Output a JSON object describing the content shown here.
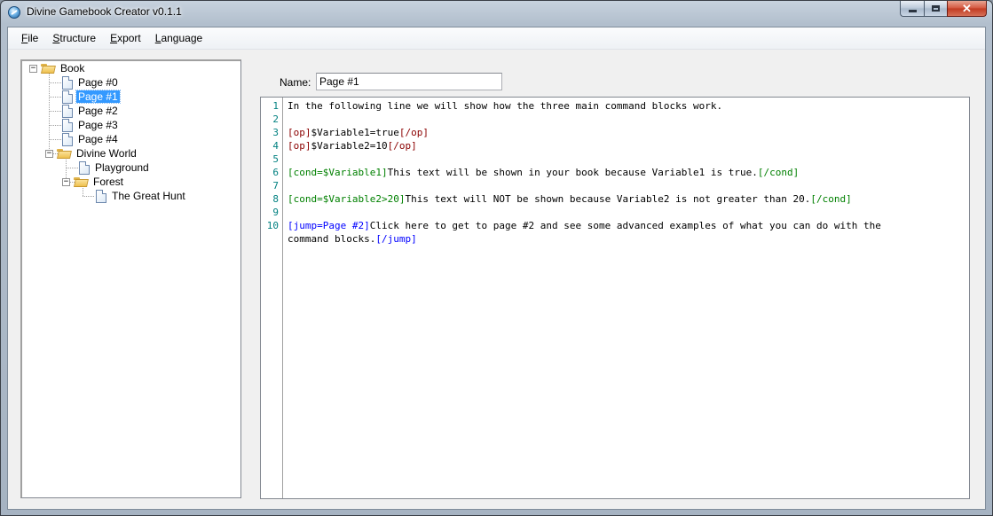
{
  "window": {
    "title": "Divine Gamebook Creator v0.1.1"
  },
  "menu": {
    "items": [
      {
        "accel": "F",
        "rest": "ile"
      },
      {
        "accel": "S",
        "rest": "tructure"
      },
      {
        "accel": "E",
        "rest": "xport"
      },
      {
        "accel": "L",
        "rest": "anguage"
      }
    ]
  },
  "tree": {
    "book": "Book",
    "pages": [
      "Page #0",
      "Page #1",
      "Page #2",
      "Page #3",
      "Page #4"
    ],
    "selected": "Page #1",
    "world": "Divine World",
    "playground": "Playground",
    "forest": "Forest",
    "hunt": "The Great Hunt",
    "expander_symbol": "−"
  },
  "editor": {
    "name_label": "Name:",
    "name_value": "Page #1",
    "line_numbers": [
      "1",
      "2",
      "3",
      "4",
      "5",
      "6",
      "7",
      "8",
      "9",
      "10"
    ],
    "lines": {
      "l1": "In the following line we will show how the three main command blocks work.",
      "l3": {
        "open": "[op]",
        "text": "$Variable1=true",
        "close": "[/op]"
      },
      "l4": {
        "open": "[op]",
        "text": "$Variable2=10",
        "close": "[/op]"
      },
      "l6": {
        "open": "[cond=$Variable1]",
        "text": "This text will be shown in your book because Variable1 is true.",
        "close": "[/cond]"
      },
      "l8": {
        "open": "[cond=$Variable2>20]",
        "text": "This text will NOT be shown because Variable2 is not greater than 20.",
        "close": "[/cond]"
      },
      "l10": {
        "open": "[jump=Page #2]",
        "text": "Click here to get to page #2 and see some advanced examples of what you can do with the"
      },
      "l10b": {
        "text": "command blocks.",
        "close": "[/jump]"
      }
    },
    "colors": {
      "op": "#8b0000",
      "cond": "#008000",
      "jump": "#0000ff",
      "line_number": "#008080"
    }
  }
}
